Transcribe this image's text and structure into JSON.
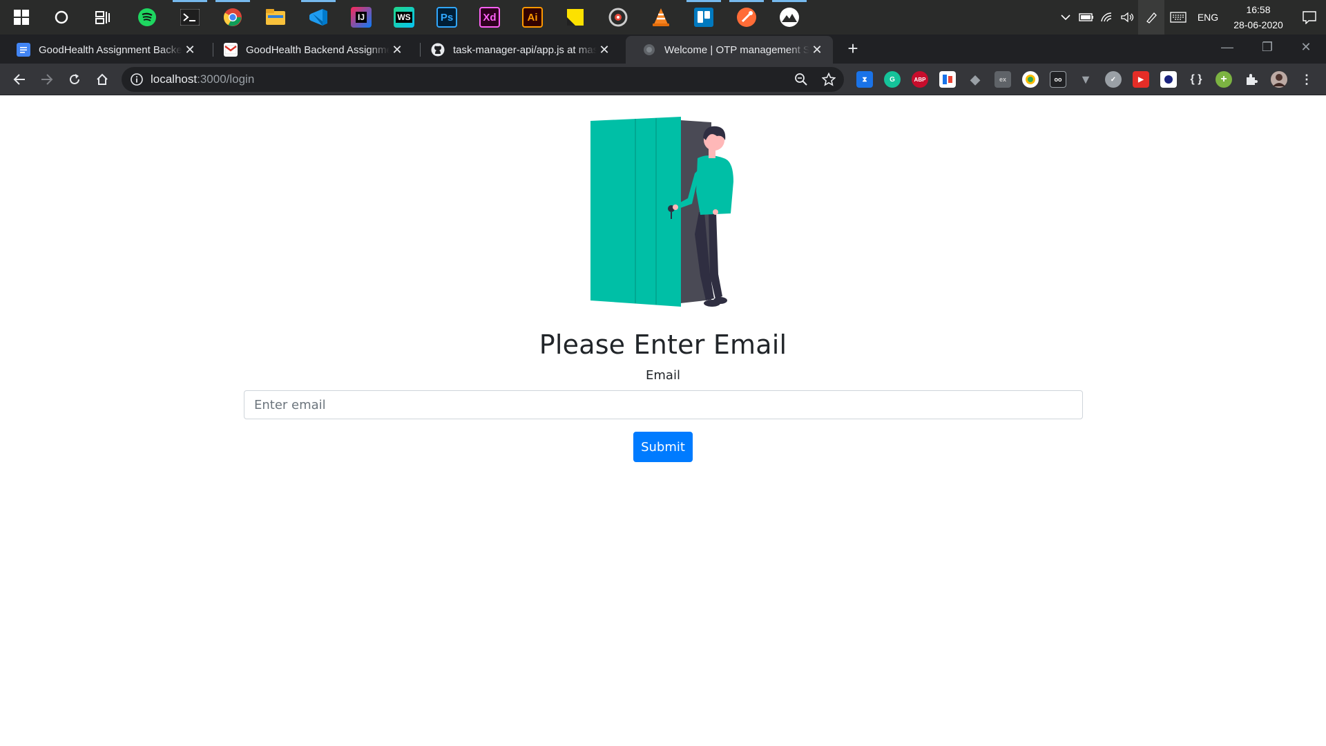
{
  "taskbar": {
    "apps": [
      {
        "icon": "windows-start-icon",
        "running": false
      },
      {
        "icon": "cortana-search-icon",
        "running": false
      },
      {
        "icon": "task-view-icon",
        "running": false
      },
      {
        "icon": "spotify-icon",
        "running": false
      },
      {
        "icon": "terminal-icon",
        "running": true
      },
      {
        "icon": "chrome-icon",
        "running": true
      },
      {
        "icon": "file-explorer-icon",
        "running": false
      },
      {
        "icon": "vscode-icon",
        "running": true
      },
      {
        "icon": "intellij-icon",
        "running": false,
        "text": "IJ"
      },
      {
        "icon": "webstorm-icon",
        "running": false,
        "text": "WS"
      },
      {
        "icon": "photoshop-icon",
        "running": false,
        "text": "Ps"
      },
      {
        "icon": "adobe-xd-icon",
        "running": false,
        "text": "Xd"
      },
      {
        "icon": "illustrator-icon",
        "running": false,
        "text": "Ai"
      },
      {
        "icon": "sticky-notes-icon",
        "running": false
      },
      {
        "icon": "media-player-icon",
        "running": false
      },
      {
        "icon": "vlc-icon",
        "running": false
      },
      {
        "icon": "trello-icon",
        "running": true
      },
      {
        "icon": "postman-icon",
        "running": true
      },
      {
        "icon": "mongodb-compass-icon",
        "running": true
      }
    ],
    "tray": {
      "lang": "ENG",
      "time": "16:58",
      "date": "28-06-2020"
    }
  },
  "browser": {
    "tabs": [
      {
        "title": "GoodHealth Assignment Backend",
        "favicon": "google-docs-icon",
        "active": false
      },
      {
        "title": "GoodHealth Backend Assignment",
        "favicon": "gmail-icon",
        "active": false
      },
      {
        "title": "task-manager-api/app.js at master",
        "favicon": "github-icon",
        "active": false
      },
      {
        "title": "Welcome | OTP management System",
        "favicon": "globe-icon",
        "active": true
      }
    ],
    "url_host": "localhost",
    "url_path": ":3000/login",
    "extensions": [
      "timer-extension-icon",
      "grammarly-icon",
      "adblock-plus-icon",
      "extension-icon",
      "puzzle-extension-icon",
      "extension-icon",
      "extension-icon",
      "extension-icon",
      "vue-devtools-icon",
      "extension-icon",
      "youtube-extension-icon",
      "extension-icon",
      "json-viewer-icon",
      "extension-icon",
      "extensions-puzzle-icon"
    ]
  },
  "page": {
    "heading": "Please Enter Email",
    "email_label": "Email",
    "email_placeholder": "Enter email",
    "email_value": "",
    "submit_label": "Submit",
    "accent_color": "#007bff",
    "illustration": "person-at-open-door-illustration",
    "illustration_color": "#00bfa6"
  }
}
